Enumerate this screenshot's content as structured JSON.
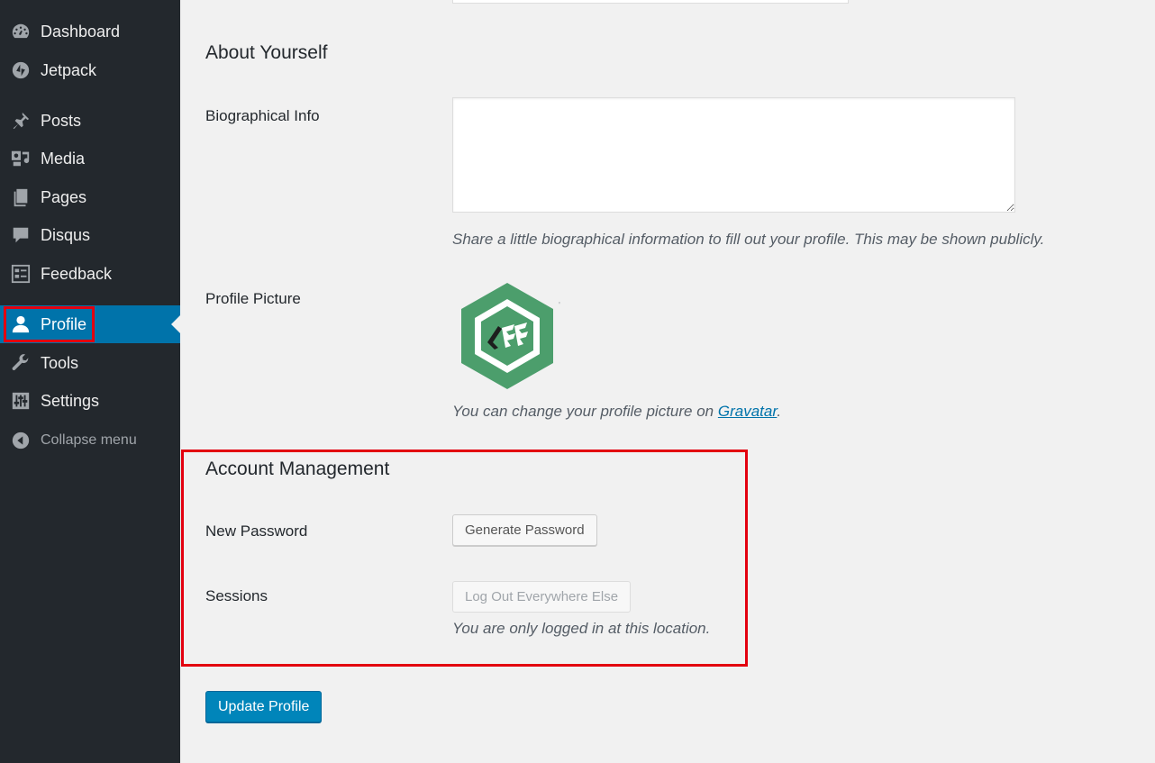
{
  "sidebar": {
    "items": [
      {
        "label": "Dashboard",
        "icon": "dashboard-icon"
      },
      {
        "label": "Jetpack",
        "icon": "jetpack-icon"
      },
      {
        "label": "Posts",
        "icon": "pushpin-icon"
      },
      {
        "label": "Media",
        "icon": "media-icon"
      },
      {
        "label": "Pages",
        "icon": "pages-icon"
      },
      {
        "label": "Disqus",
        "icon": "comment-icon"
      },
      {
        "label": "Feedback",
        "icon": "feedback-icon"
      },
      {
        "label": "Profile",
        "icon": "user-icon",
        "active": true
      },
      {
        "label": "Tools",
        "icon": "wrench-icon"
      },
      {
        "label": "Settings",
        "icon": "settings-icon"
      }
    ],
    "collapse_label": "Collapse menu"
  },
  "about": {
    "title": "About Yourself",
    "bio_label": "Biographical Info",
    "bio_value": "",
    "bio_description": "Share a little biographical information to fill out your profile. This may be shown publicly.",
    "picture_label": "Profile Picture",
    "picture_desc_prefix": "You can change your profile picture on ",
    "picture_link": "Gravatar",
    "picture_desc_suffix": "."
  },
  "account": {
    "title": "Account Management",
    "password_label": "New Password",
    "generate_button": "Generate Password",
    "sessions_label": "Sessions",
    "logout_button": "Log Out Everywhere Else",
    "sessions_description": "You are only logged in at this location."
  },
  "submit": {
    "label": "Update Profile"
  },
  "colors": {
    "sidebar_bg": "#23282d",
    "active_bg": "#0073aa",
    "primary_button": "#0085ba",
    "highlight_border": "#e3000f",
    "avatar_green": "#4c9e6c"
  }
}
